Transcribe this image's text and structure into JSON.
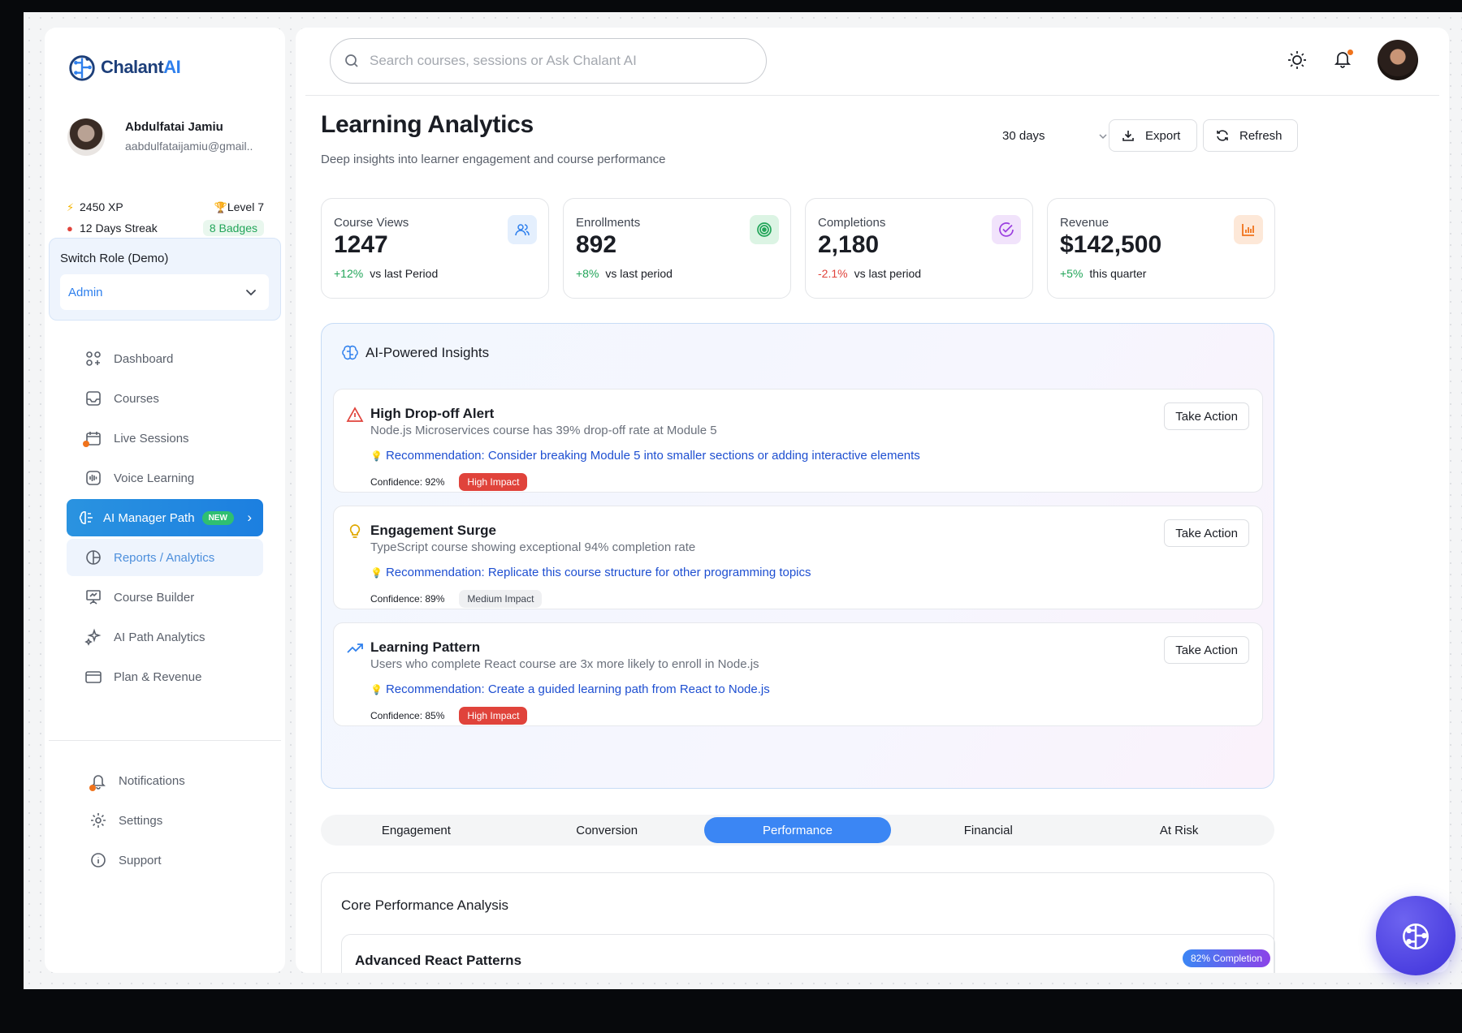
{
  "brand": {
    "name_part1": "Chalant",
    "name_part2": "AI",
    "accent": "#2f80ed"
  },
  "user": {
    "name": "Abdulfatai Jamiu",
    "email": "aabdulfataijamiu@gmail..",
    "xp": "2450 XP",
    "level": "Level 7",
    "streak": "12 Days Streak",
    "badges": "8 Badges"
  },
  "switch_role": {
    "title": "Switch Role (Demo)",
    "selected": "Admin"
  },
  "nav": {
    "dashboard": "Dashboard",
    "courses": "Courses",
    "live_sessions": "Live Sessions",
    "voice_learning": "Voice Learning",
    "ai_manager_path": "AI Manager Path",
    "new_badge": "NEW",
    "reports": "Reports / Analytics",
    "course_builder": "Course Builder",
    "ai_path_analytics": "AI Path Analytics",
    "plan_revenue": "Plan & Revenue",
    "notifications": "Notifications",
    "settings": "Settings",
    "support": "Support"
  },
  "search": {
    "placeholder": "Search courses, sessions or Ask Chalant AI"
  },
  "header": {
    "title": "Learning Analytics",
    "subtitle": "Deep insights into learner engagement and course performance",
    "range": "30 days",
    "export_label": "Export",
    "refresh_label": "Refresh"
  },
  "kpis": [
    {
      "label": "Course Views",
      "value": "1247",
      "delta": "+12%",
      "delta_dir": "up",
      "note": "vs last Period",
      "icon": "users-icon",
      "icon_bg": "#e4effd",
      "icon_color": "#2f80ed"
    },
    {
      "label": "Enrollments",
      "value": "892",
      "delta": "+8%",
      "delta_dir": "up",
      "note": "vs last period",
      "icon": "target-icon",
      "icon_bg": "#dcf4e4",
      "icon_color": "#22a559"
    },
    {
      "label": "Completions",
      "value": "2,180",
      "delta": "-2.1%",
      "delta_dir": "down",
      "note": "vs last period",
      "icon": "check-circle-icon",
      "icon_bg": "#f1e3fb",
      "icon_color": "#9b3fe0"
    },
    {
      "label": "Revenue",
      "value": "$142,500",
      "delta": "+5%",
      "delta_dir": "up",
      "note": "this quarter",
      "icon": "bar-chart-icon",
      "icon_bg": "#fde8d8",
      "icon_color": "#f0731c"
    }
  ],
  "insights": {
    "title": "AI-Powered Insights",
    "action_label": "Take Action",
    "items": [
      {
        "title": "High Drop-off Alert",
        "desc": "Node.js Microservices course has 39% drop-off rate at Module 5",
        "rec": "Recommendation: Consider breaking Module 5 into smaller sections or adding interactive elements",
        "confidence": "Confidence: 92%",
        "impact": "High Impact",
        "icon": "warning-icon"
      },
      {
        "title": "Engagement Surge",
        "desc": "TypeScript course showing exceptional 94% completion rate",
        "rec": "Recommendation: Replicate this course structure for other programming topics",
        "confidence": "Confidence: 89%",
        "impact": "Medium Impact",
        "icon": "lightbulb-icon"
      },
      {
        "title": "Learning Pattern",
        "desc": "Users who complete React course are 3x more likely to enroll in Node.js",
        "rec": "Recommendation: Create a guided learning path from React to Node.js",
        "confidence": "Confidence: 85%",
        "impact": "High Impact",
        "icon": "trending-up-icon"
      }
    ]
  },
  "tabs": [
    "Engagement",
    "Conversion",
    "Performance",
    "Financial",
    "At Risk"
  ],
  "active_tab": "Performance",
  "core": {
    "title": "Core Performance Analysis",
    "course": "Advanced React Patterns",
    "badge": "82% Completion"
  }
}
